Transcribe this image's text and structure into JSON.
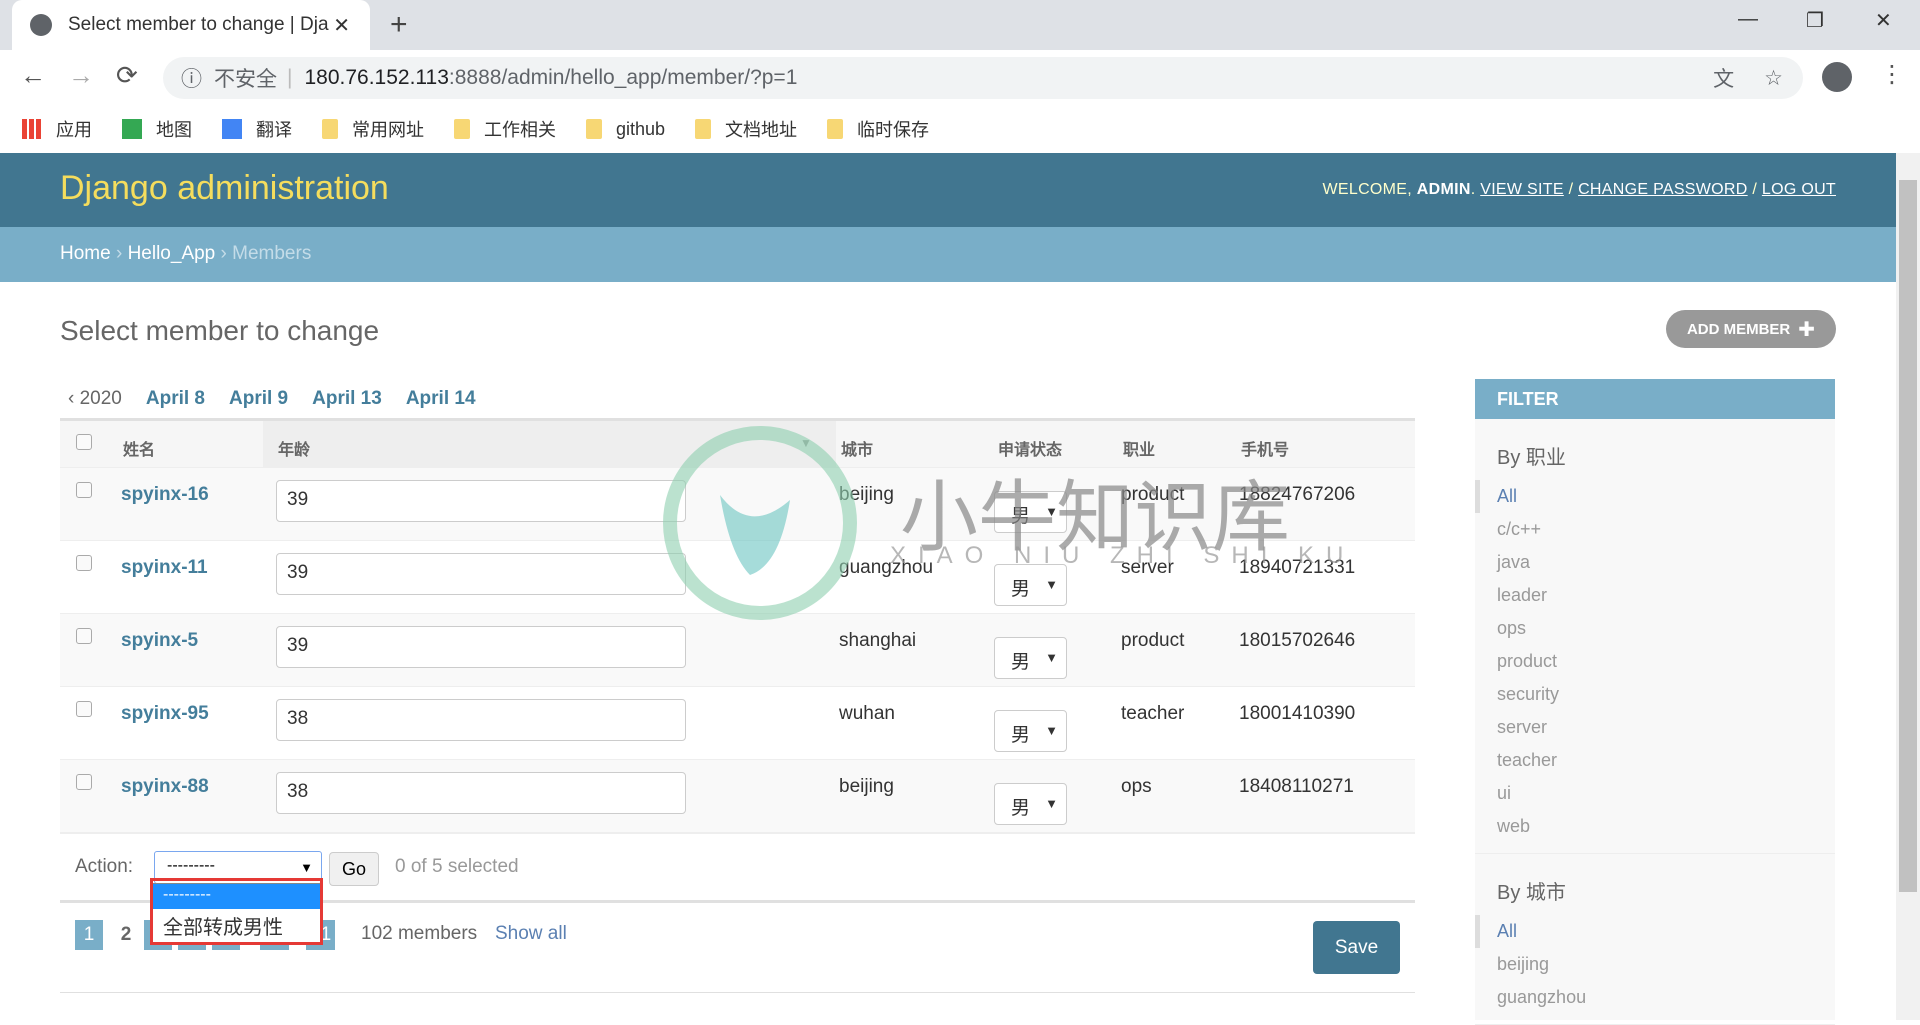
{
  "browser": {
    "tab_title": "Select member to change | Dja",
    "new_tab": "+",
    "minimize": "—",
    "restore": "❐",
    "close": "✕",
    "back": "←",
    "forward": "→",
    "reload": "⟳",
    "security": "不安全",
    "url_host": "180.76.152.113",
    "url_path": ":8888/admin/hello_app/member/?p=1",
    "bookmarks": [
      {
        "label": "应用",
        "icon": "apps-icon"
      },
      {
        "label": "地图",
        "icon": "maps-icon"
      },
      {
        "label": "翻译",
        "icon": "translate-icon"
      },
      {
        "label": "常用网址",
        "icon": "folder-icon"
      },
      {
        "label": "工作相关",
        "icon": "folder-icon"
      },
      {
        "label": "github",
        "icon": "folder-icon"
      },
      {
        "label": "文档地址",
        "icon": "folder-icon"
      },
      {
        "label": "临时保存",
        "icon": "folder-icon"
      }
    ]
  },
  "header": {
    "brand": "Django administration",
    "welcome": "Welcome,",
    "user": "admin",
    "view_site": "View site",
    "change_password": "Change password",
    "log_out": "Log out"
  },
  "breadcrumbs": {
    "home": "Home",
    "app": "Hello_App",
    "current": "Members"
  },
  "page": {
    "title": "Select member to change",
    "add_button": "ADD MEMBER"
  },
  "date_hierarchy": {
    "back": "‹ 2020",
    "dates": [
      "April 8",
      "April 9",
      "April 13",
      "April 14"
    ]
  },
  "table": {
    "columns": [
      "姓名",
      "年龄",
      "城市",
      "申请状态",
      "职业",
      "手机号"
    ],
    "rows": [
      {
        "name": "spyinx-16",
        "age": "39",
        "city": "beijing",
        "status": "男",
        "job": "product",
        "phone": "18824767206"
      },
      {
        "name": "spyinx-11",
        "age": "39",
        "city": "guangzhou",
        "status": "男",
        "job": "server",
        "phone": "18940721331"
      },
      {
        "name": "spyinx-5",
        "age": "39",
        "city": "shanghai",
        "status": "男",
        "job": "product",
        "phone": "18015702646"
      },
      {
        "name": "spyinx-95",
        "age": "38",
        "city": "wuhan",
        "status": "男",
        "job": "teacher",
        "phone": "18001410390"
      },
      {
        "name": "spyinx-88",
        "age": "38",
        "city": "beijing",
        "status": "男",
        "job": "ops",
        "phone": "18408110271"
      }
    ]
  },
  "actions": {
    "label": "Action:",
    "selected": "---------",
    "options": [
      "---------",
      "全部转成男性"
    ],
    "go": "Go",
    "counter": "0 of 5 selected"
  },
  "pagination": {
    "pages": [
      "1",
      "2",
      "3",
      "4",
      "5",
      "...",
      "20",
      "21"
    ],
    "current": "1",
    "count": "102 members",
    "show_all": "Show all",
    "save": "Save"
  },
  "filter": {
    "title": "FILTER",
    "groups": [
      {
        "title": "By 职业",
        "items": [
          "All",
          "c/c++",
          "java",
          "leader",
          "ops",
          "product",
          "security",
          "server",
          "teacher",
          "ui",
          "web"
        ]
      },
      {
        "title": "By 城市",
        "items": [
          "All",
          "beijing",
          "guangzhou"
        ]
      }
    ]
  },
  "watermark": {
    "text": "小牛知识库",
    "sub": "XIAO NIU ZHI SHI KU"
  },
  "colors": {
    "header": "#417690",
    "breadcrumbs": "#79aec8",
    "link": "#447e9b",
    "brand": "#f5dd5d",
    "highlight": "#1e90ff",
    "annotation": "#e53935"
  }
}
